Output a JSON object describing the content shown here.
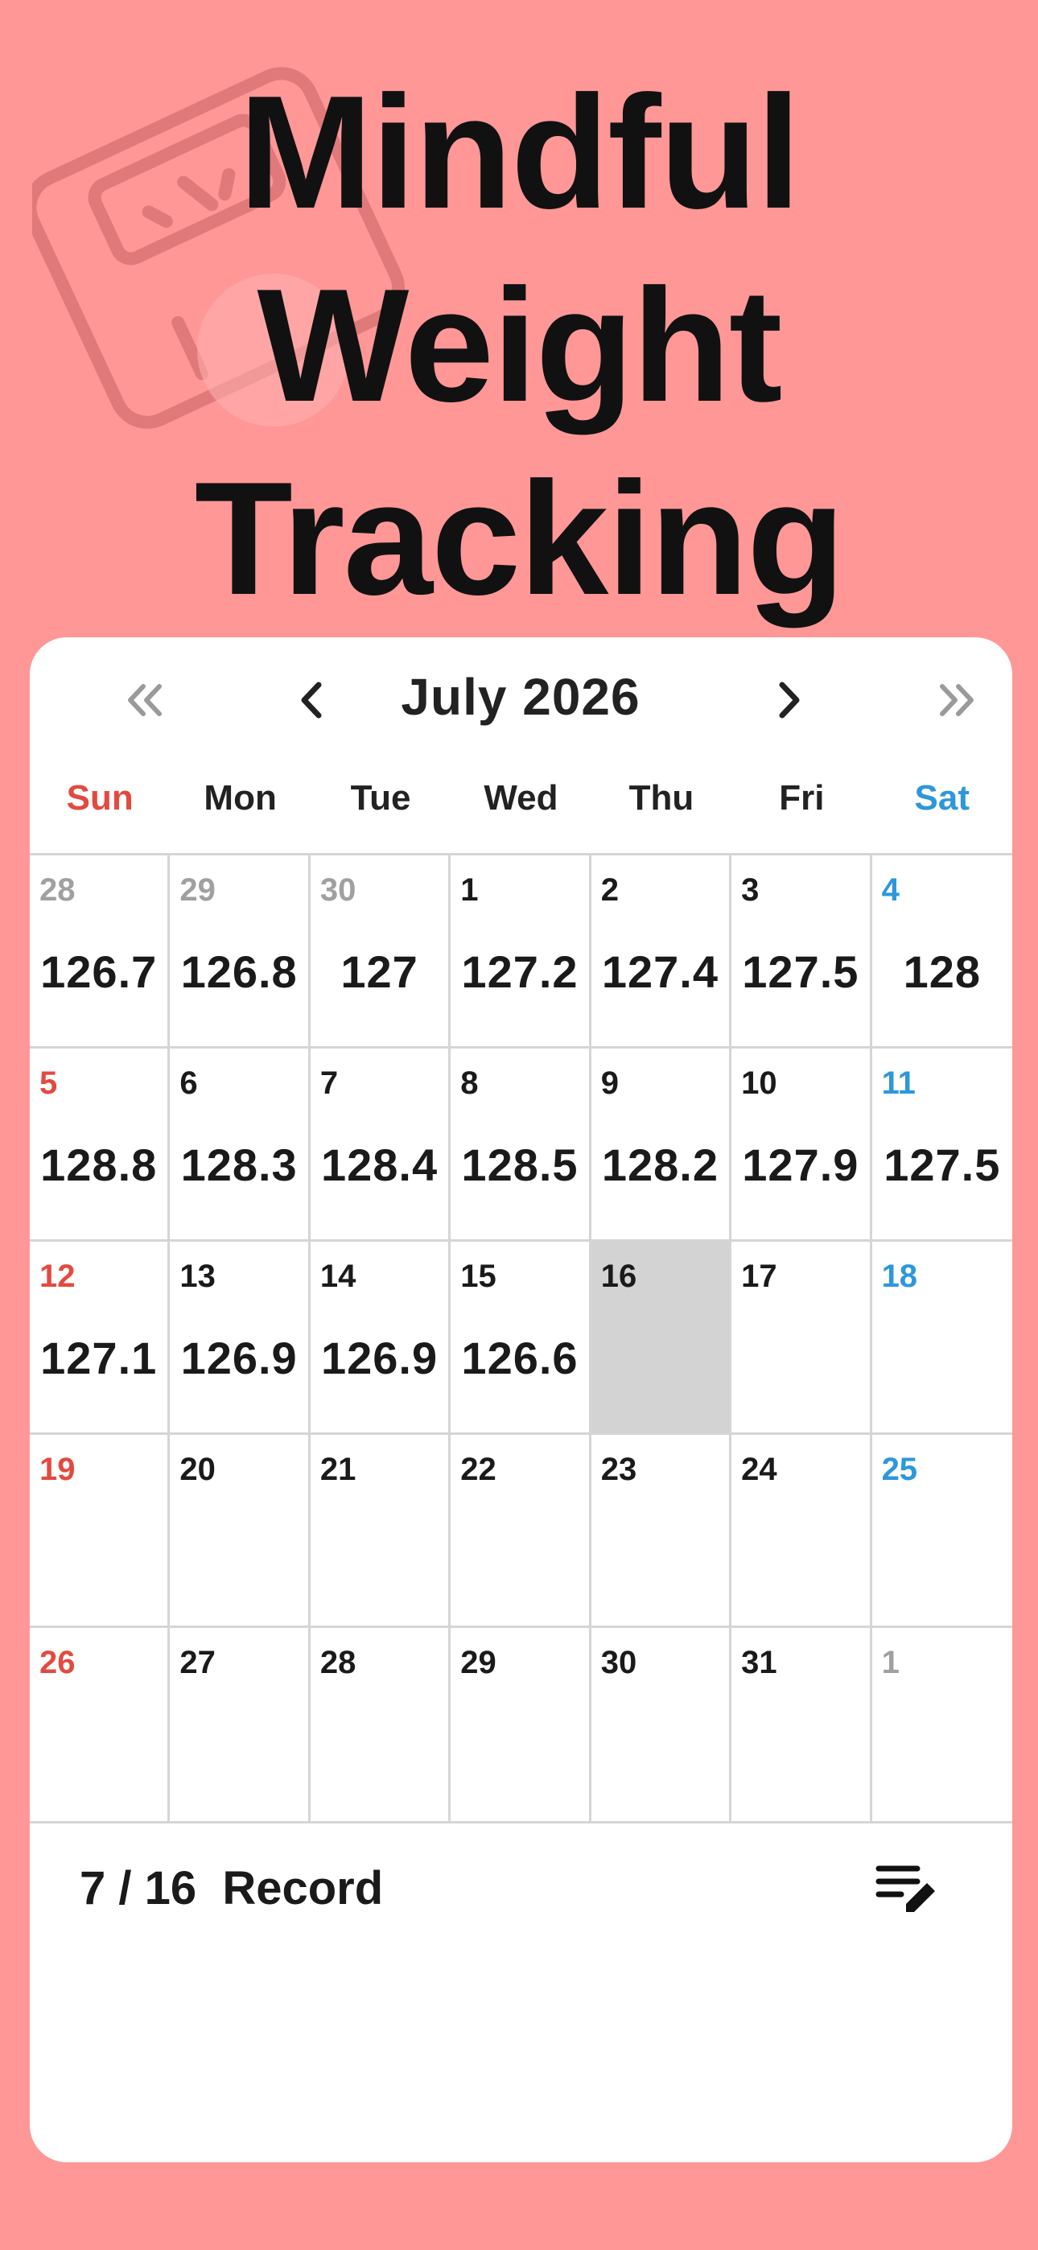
{
  "title": {
    "line1": "Mindful",
    "line2": "Weight",
    "line3": "Tracking"
  },
  "background_icon": "bathroom-scale-icon",
  "colors": {
    "background": "#FF9797",
    "sunday": "#E34A3F",
    "saturday": "#2E97DB",
    "muted": "#A0A0A0",
    "today_bg": "#D3D3D3"
  },
  "calendar": {
    "month_title": "July 2026",
    "nav": {
      "prev_year_icon": "double-chevron-left-icon",
      "prev_month_icon": "chevron-left-icon",
      "next_month_icon": "chevron-right-icon",
      "next_year_icon": "double-chevron-right-icon"
    },
    "weekdays": [
      "Sun",
      "Mon",
      "Tue",
      "Wed",
      "Thu",
      "Fri",
      "Sat"
    ],
    "weeks": [
      [
        {
          "day": "28",
          "weight": "126.7",
          "muted": true
        },
        {
          "day": "29",
          "weight": "126.8",
          "muted": true
        },
        {
          "day": "30",
          "weight": "127",
          "muted": true
        },
        {
          "day": "1",
          "weight": "127.2"
        },
        {
          "day": "2",
          "weight": "127.4"
        },
        {
          "day": "3",
          "weight": "127.5"
        },
        {
          "day": "4",
          "weight": "128"
        }
      ],
      [
        {
          "day": "5",
          "weight": "128.8"
        },
        {
          "day": "6",
          "weight": "128.3"
        },
        {
          "day": "7",
          "weight": "128.4"
        },
        {
          "day": "8",
          "weight": "128.5"
        },
        {
          "day": "9",
          "weight": "128.2"
        },
        {
          "day": "10",
          "weight": "127.9"
        },
        {
          "day": "11",
          "weight": "127.5"
        }
      ],
      [
        {
          "day": "12",
          "weight": "127.1"
        },
        {
          "day": "13",
          "weight": "126.9"
        },
        {
          "day": "14",
          "weight": "126.9"
        },
        {
          "day": "15",
          "weight": "126.6"
        },
        {
          "day": "16",
          "weight": "",
          "today": true
        },
        {
          "day": "17",
          "weight": ""
        },
        {
          "day": "18",
          "weight": ""
        }
      ],
      [
        {
          "day": "19",
          "weight": ""
        },
        {
          "day": "20",
          "weight": ""
        },
        {
          "day": "21",
          "weight": ""
        },
        {
          "day": "22",
          "weight": ""
        },
        {
          "day": "23",
          "weight": ""
        },
        {
          "day": "24",
          "weight": ""
        },
        {
          "day": "25",
          "weight": ""
        }
      ],
      [
        {
          "day": "26",
          "weight": ""
        },
        {
          "day": "27",
          "weight": ""
        },
        {
          "day": "28",
          "weight": ""
        },
        {
          "day": "29",
          "weight": ""
        },
        {
          "day": "30",
          "weight": ""
        },
        {
          "day": "31",
          "weight": ""
        },
        {
          "day": "1",
          "weight": "",
          "muted": true
        }
      ]
    ]
  },
  "footer": {
    "record_label": "7 / 16  Record",
    "edit_icon": "edit-list-icon"
  }
}
